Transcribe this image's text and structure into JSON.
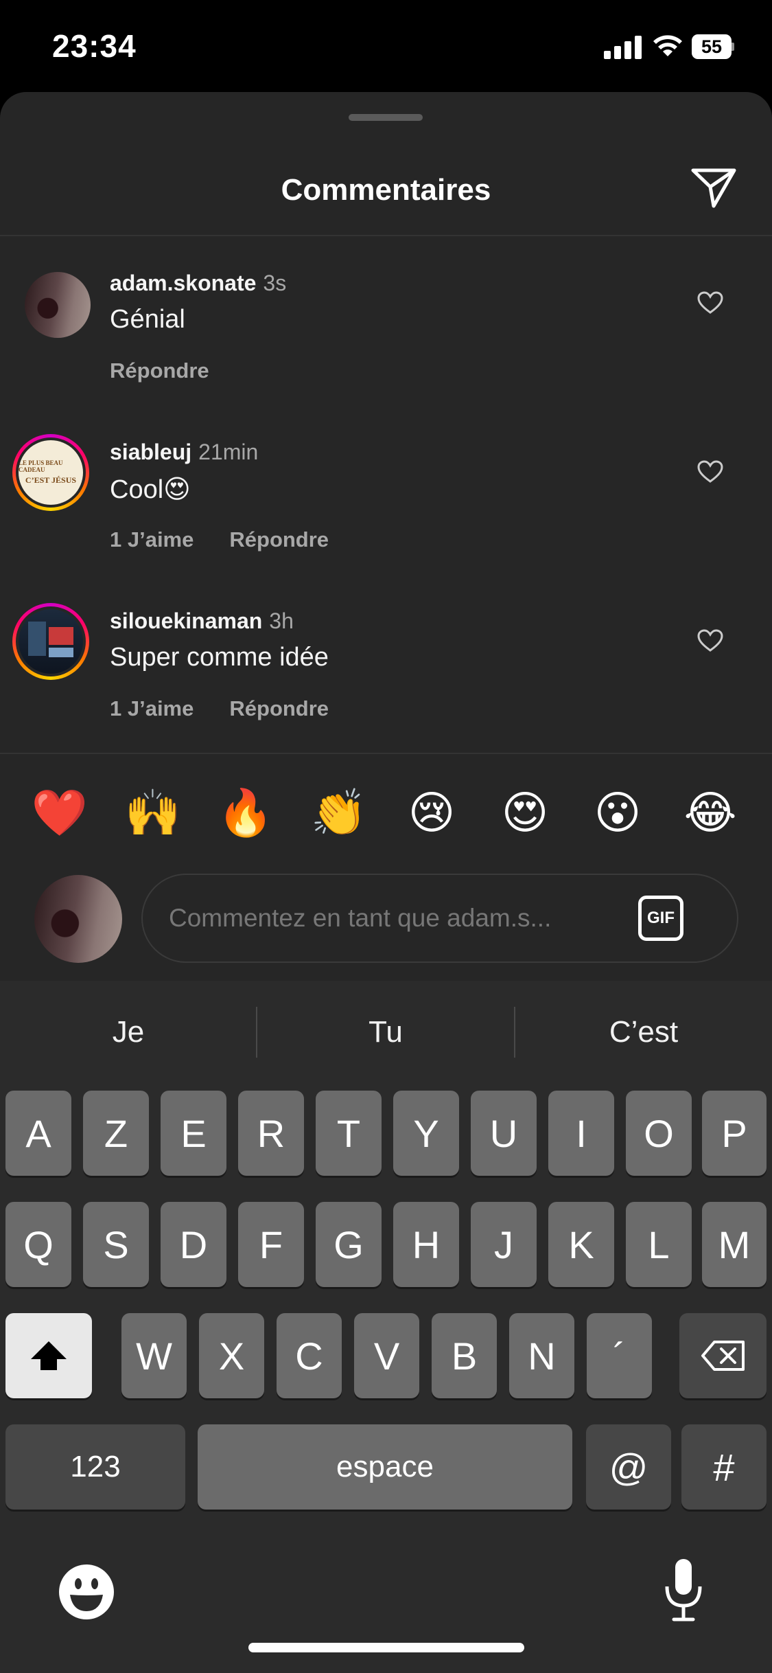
{
  "status_bar": {
    "time": "23:34",
    "battery": "55"
  },
  "sheet": {
    "title": "Commentaires"
  },
  "comments": [
    {
      "username": "adam.skonate",
      "time": "3s",
      "text": "Génial",
      "likes": "",
      "reply": "Répondre"
    },
    {
      "username": "siableuj",
      "time": "21min",
      "text": "Cool😍",
      "likes": "1 J’aime",
      "reply": "Répondre",
      "thumb_line1": "LE PLUS BEAU CADEAU",
      "thumb_line2": "C’EST JÉSUS"
    },
    {
      "username": "silouekinaman",
      "time": "3h",
      "text": "Super comme idée",
      "likes": "1 J’aime",
      "reply": "Répondre"
    }
  ],
  "emojis": [
    "❤️",
    "🙌",
    "🔥",
    "👏",
    "😢",
    "😍",
    "😮",
    "😂"
  ],
  "input": {
    "placeholder": "Commentez en tant que adam.s...",
    "gif": "GIF"
  },
  "keyboard": {
    "predictions": [
      "Je",
      "Tu",
      "C’est"
    ],
    "row1": [
      "A",
      "Z",
      "E",
      "R",
      "T",
      "Y",
      "U",
      "I",
      "O",
      "P"
    ],
    "row2": [
      "Q",
      "S",
      "D",
      "F",
      "G",
      "H",
      "J",
      "K",
      "L",
      "M"
    ],
    "row3": [
      "W",
      "X",
      "C",
      "V",
      "B",
      "N",
      "´"
    ],
    "numbers": "123",
    "space": "espace",
    "at": "@",
    "hash": "#"
  },
  "icons": {
    "share": "paper-plane-icon",
    "heart": "heart-outline-icon",
    "shift": "shift-icon",
    "backspace": "backspace-icon",
    "emoji_keyboard": "emoji-face-icon",
    "mic": "microphone-icon"
  }
}
